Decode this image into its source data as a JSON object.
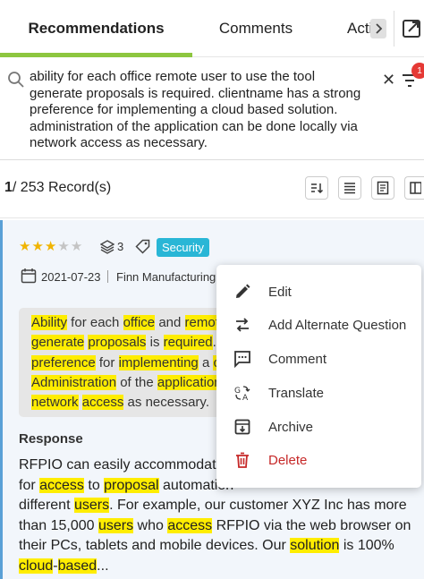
{
  "tabs": [
    {
      "label": "Recommendations",
      "active": true
    },
    {
      "label": "Comments",
      "active": false
    },
    {
      "label": "Activity",
      "active": false
    }
  ],
  "search": {
    "query": "ability for each office remote user to use the tool generate proposals is required. clientname has a strong preference for implementing a cloud based solution. administration of the application can be done locally via network access as necessary.",
    "filter_badge": "1"
  },
  "toolbar": {
    "current": "1",
    "total": "253",
    "unit": "Record(s)"
  },
  "record": {
    "rating": 3,
    "rating_max": 5,
    "alternate_count": "3",
    "tag": "Security",
    "date": "2021-07-23",
    "company": "Finn Manufacturing C",
    "question_lines": [
      [
        {
          "t": "Ability",
          "h": true
        },
        {
          "t": " for each ",
          "h": false
        },
        {
          "t": "office",
          "h": true
        },
        {
          "t": " and ",
          "h": false
        },
        {
          "t": "remote",
          "h": true
        }
      ],
      [
        {
          "t": "generate",
          "h": true
        },
        {
          "t": " ",
          "h": false
        },
        {
          "t": "proposals",
          "h": true
        },
        {
          "t": " is ",
          "h": false
        },
        {
          "t": "required",
          "h": true
        },
        {
          "t": ". [",
          "h": false
        }
      ],
      [
        {
          "t": "preference",
          "h": true
        },
        {
          "t": " for ",
          "h": false
        },
        {
          "t": "implementing",
          "h": true
        },
        {
          "t": " a ",
          "h": false
        },
        {
          "t": "c",
          "h": true
        }
      ],
      [
        {
          "t": "Administration",
          "h": true
        },
        {
          "t": " of the ",
          "h": false
        },
        {
          "t": "application",
          "h": true
        }
      ],
      [
        {
          "t": "network",
          "h": true
        },
        {
          "t": " ",
          "h": false
        },
        {
          "t": "access",
          "h": true
        },
        {
          "t": " as necessary.",
          "h": false
        }
      ]
    ],
    "response_label": "Response",
    "response_lines": [
      [
        {
          "t": "RFPIO can easily accommodate",
          "h": false
        }
      ],
      [
        {
          "t": "for ",
          "h": false
        },
        {
          "t": "access",
          "h": true
        },
        {
          "t": " to ",
          "h": false
        },
        {
          "t": "proposal",
          "h": true
        },
        {
          "t": " automation",
          "h": false
        }
      ],
      [
        {
          "t": "different ",
          "h": false
        },
        {
          "t": "users",
          "h": true
        },
        {
          "t": ". For example, our customer XYZ Inc has more",
          "h": false
        }
      ],
      [
        {
          "t": "than 15,000 ",
          "h": false
        },
        {
          "t": "users",
          "h": true
        },
        {
          "t": " who ",
          "h": false
        },
        {
          "t": "access",
          "h": true
        },
        {
          "t": " RFPIO via the web browser on",
          "h": false
        }
      ],
      [
        {
          "t": "their PCs, tablets and mobile devices. Our ",
          "h": false
        },
        {
          "t": "solution",
          "h": true
        },
        {
          "t": " is 100%",
          "h": false
        }
      ],
      [
        {
          "t": "cloud",
          "h": true
        },
        {
          "t": "-",
          "h": false
        },
        {
          "t": "based",
          "h": true
        },
        {
          "t": "...",
          "h": false
        }
      ]
    ]
  },
  "menu": {
    "items": [
      {
        "label": "Edit",
        "icon": "pencil-icon"
      },
      {
        "label": "Add Alternate Question",
        "icon": "swap-arrows-icon"
      },
      {
        "label": "Comment",
        "icon": "comment-icon"
      },
      {
        "label": "Translate",
        "icon": "translate-icon"
      },
      {
        "label": "Archive",
        "icon": "archive-icon"
      },
      {
        "label": "Delete",
        "icon": "trash-icon"
      }
    ]
  },
  "colors": {
    "accent_green": "#8dc63f",
    "highlight": "#ffed00",
    "tag_bg": "#29b6d6",
    "star": "#f0b400",
    "delete": "#c62828"
  }
}
